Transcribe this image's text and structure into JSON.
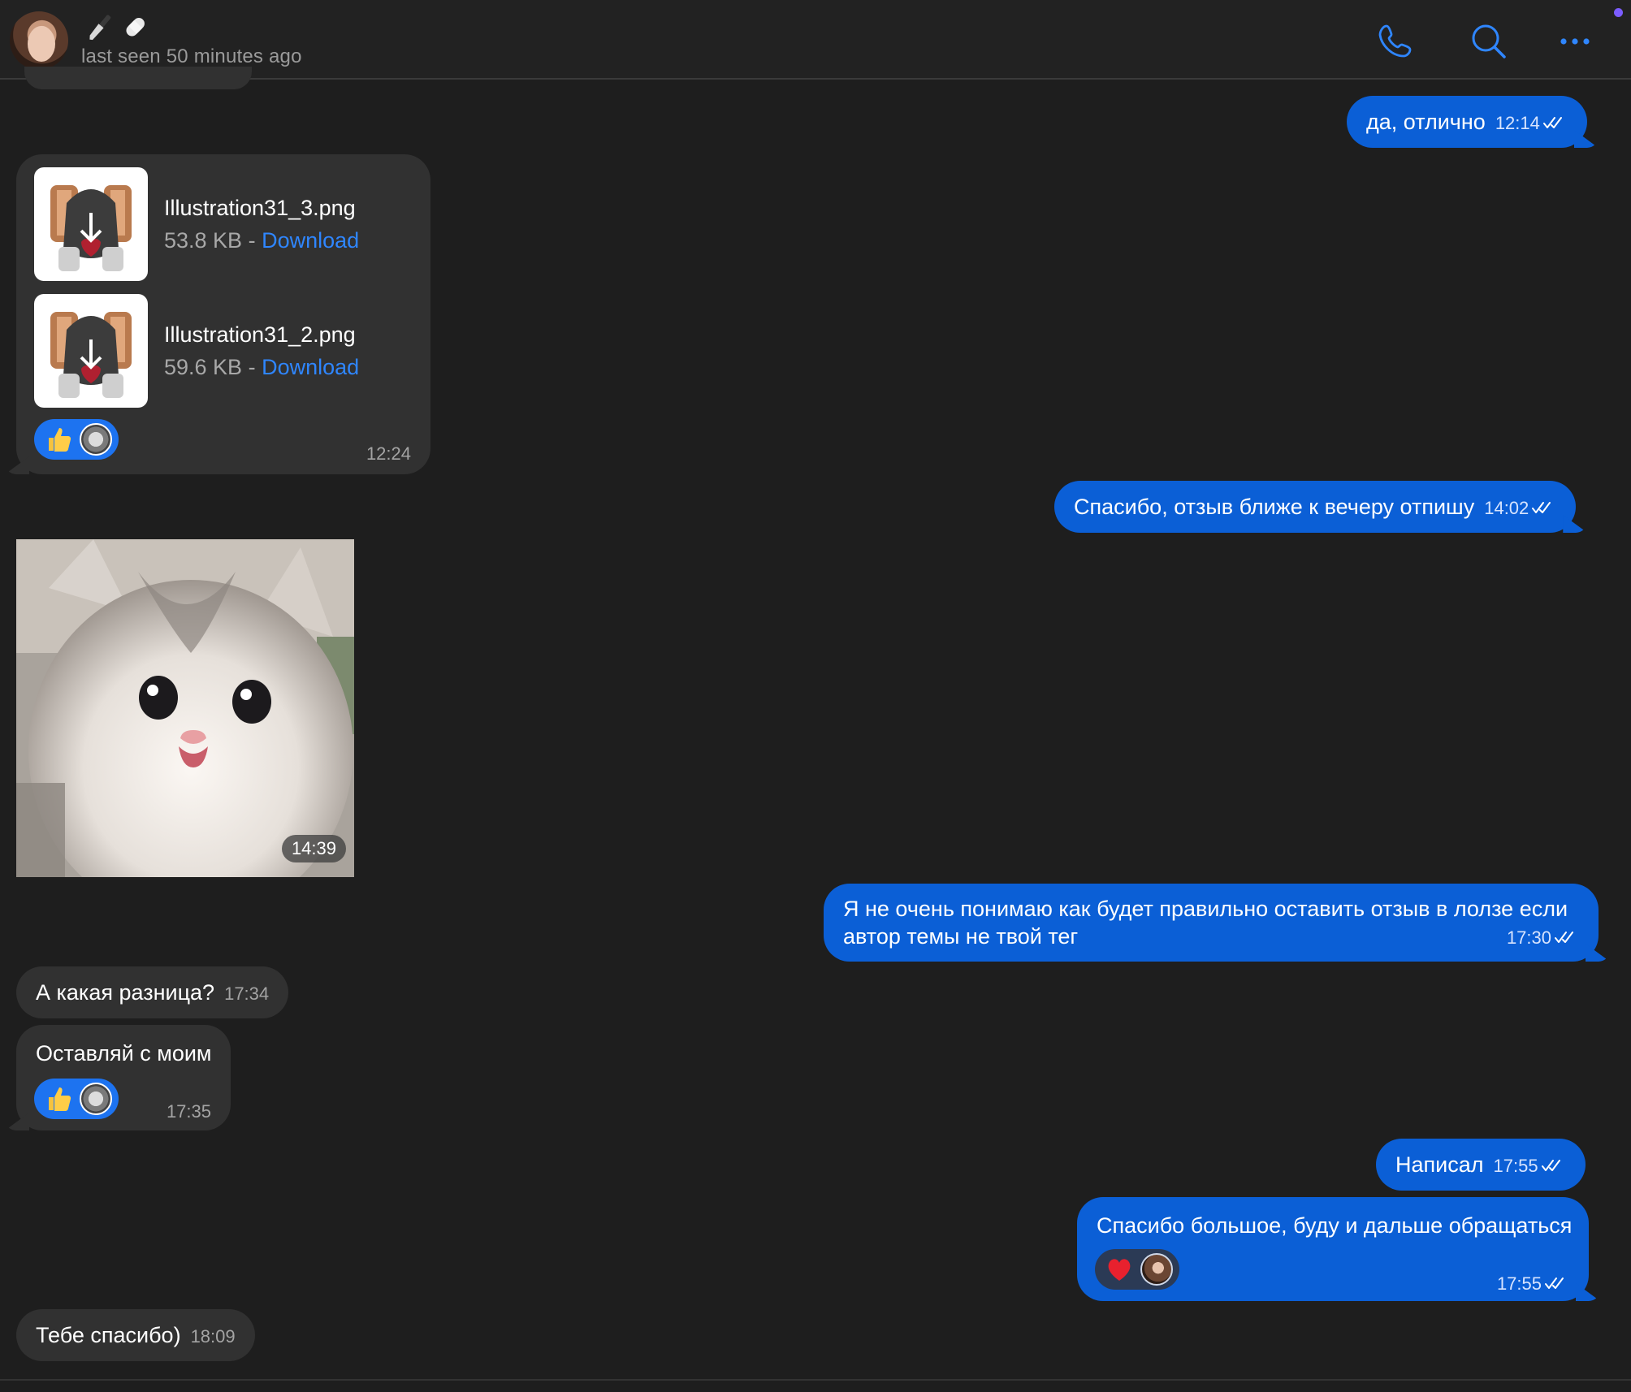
{
  "header": {
    "contact_emoji": "🔪🩹",
    "status": "last seen 50 minutes ago"
  },
  "icons": {
    "call": "phone-icon",
    "search": "search-icon",
    "more": "more-dots-icon"
  },
  "colors": {
    "accent": "#0b5fd6",
    "incoming_bubble": "#313131",
    "background": "#1e1e1e",
    "link": "#2f86ff"
  },
  "messages": [
    {
      "id": "m1",
      "side": "out",
      "text": "да, отлично",
      "time": "12:14"
    },
    {
      "id": "m2",
      "side": "in",
      "type": "files",
      "time": "12:24",
      "files": [
        {
          "name": "Illustration31_3.png",
          "size": "53.8 KB",
          "sep": " - ",
          "action": "Download"
        },
        {
          "name": "Illustration31_2.png",
          "size": "59.6 KB",
          "sep": " - ",
          "action": "Download"
        }
      ],
      "reaction": "👍"
    },
    {
      "id": "m3",
      "side": "out",
      "text": "Спасибо, отзыв ближе к вечеру отпишу",
      "time": "14:02"
    },
    {
      "id": "m4",
      "side": "in",
      "type": "photo",
      "time": "14:39"
    },
    {
      "id": "m5",
      "side": "out",
      "line1": "Я не очень понимаю как будет правильно оставить отзыв в лолзе если",
      "line2": "автор темы не твой тег",
      "time": "17:30"
    },
    {
      "id": "m6",
      "side": "in",
      "text": "А какая разница?",
      "time": "17:34"
    },
    {
      "id": "m7",
      "side": "in",
      "text": "Оставляй с моим",
      "time": "17:35",
      "reaction": "👍"
    },
    {
      "id": "m8",
      "side": "out",
      "text": "Написал",
      "time": "17:55"
    },
    {
      "id": "m9",
      "side": "out",
      "text": "Спасибо большое, буду и дальше обращаться",
      "time": "17:55",
      "reaction": "❤️"
    },
    {
      "id": "m10",
      "side": "in",
      "text": "Тебе спасибо)",
      "time": "18:09"
    }
  ]
}
